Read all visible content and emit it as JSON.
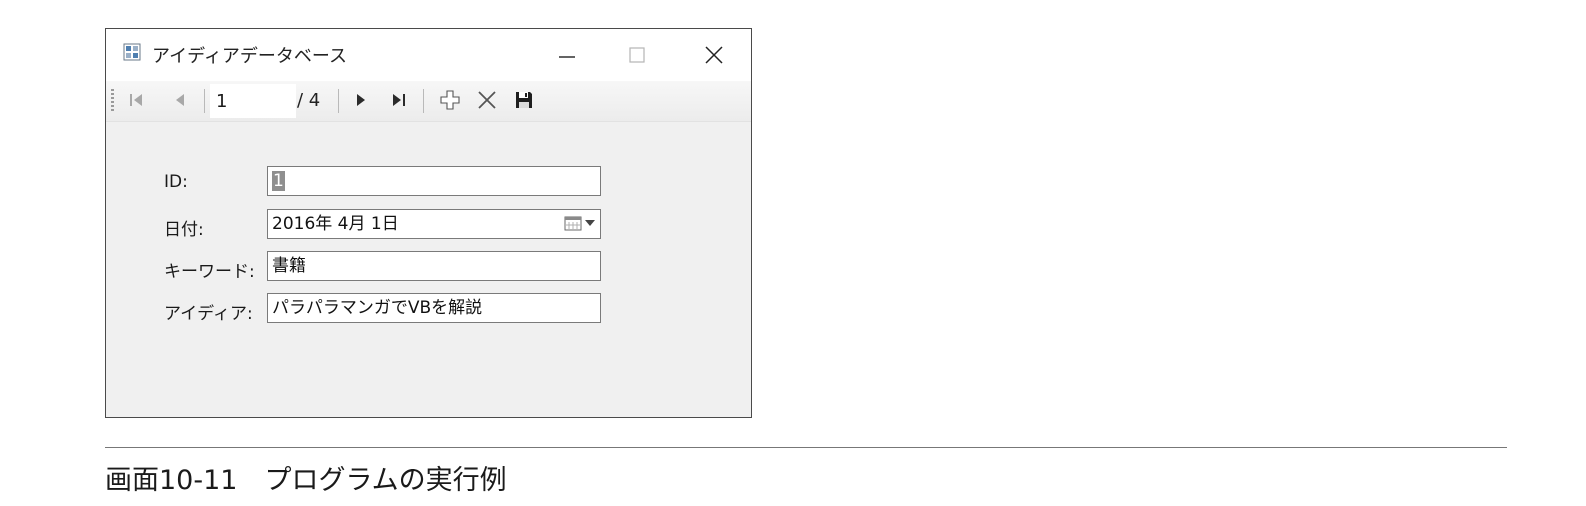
{
  "window": {
    "title": "アイディアデータベース"
  },
  "navigator": {
    "position": "1",
    "count": "/ 4"
  },
  "form": {
    "id_label": "ID:",
    "id_value": "1",
    "date_label": "日付:",
    "date_value": "2016年  4月  1日",
    "keyword_label": "キーワード:",
    "keyword_value": "書籍",
    "idea_label": "アイディア:",
    "idea_value": "パラパラマンガでVBを解説"
  },
  "caption": "画面10-11　プログラムの実行例"
}
